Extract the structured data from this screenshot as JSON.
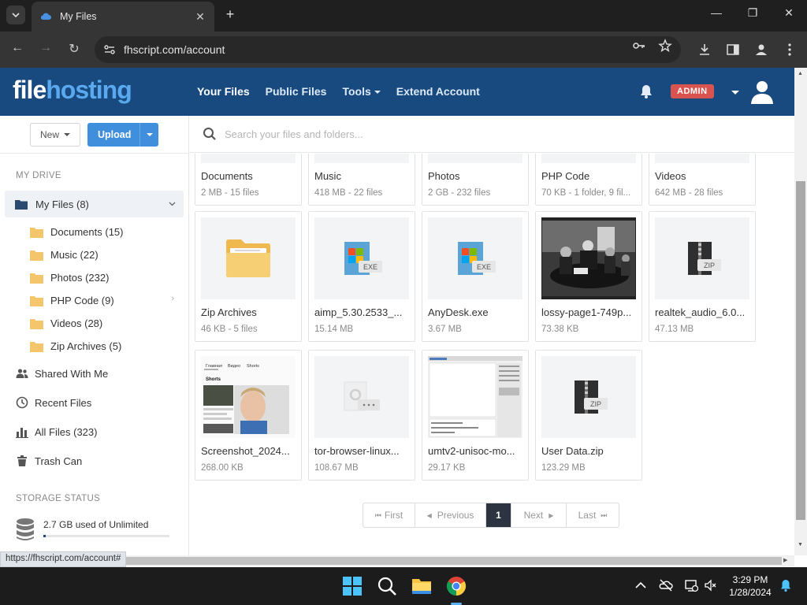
{
  "browser": {
    "tab_title": "My Files",
    "url": "fhscript.com/account",
    "status_url": "https://fhscript.com/account#"
  },
  "site": {
    "logo_part1": "file",
    "logo_part2": "hosting",
    "nav": {
      "your_files": "Your Files",
      "public_files": "Public Files",
      "tools": "Tools",
      "extend_account": "Extend Account"
    },
    "admin_badge": "ADMIN"
  },
  "sidebar": {
    "new_label": "New",
    "upload_label": "Upload",
    "my_drive_heading": "MY DRIVE",
    "my_files": "My Files (8)",
    "folders": [
      {
        "label": "Documents (15)"
      },
      {
        "label": "Music (22)"
      },
      {
        "label": "Photos (232)"
      },
      {
        "label": "PHP Code (9)"
      },
      {
        "label": "Videos (28)"
      },
      {
        "label": "Zip Archives (5)"
      }
    ],
    "shared": "Shared With Me",
    "recent": "Recent Files",
    "all_files": "All Files (323)",
    "trash": "Trash Can",
    "storage_heading": "STORAGE STATUS",
    "storage_text": "2.7 GB used of Unlimited",
    "storage_used_fraction": 0.02
  },
  "search": {
    "placeholder": "Search your files and folders..."
  },
  "top_row": [
    {
      "name": "Documents",
      "meta": "2 MB - 15 files"
    },
    {
      "name": "Music",
      "meta": "418 MB - 22 files"
    },
    {
      "name": "Photos",
      "meta": "2 GB - 232 files"
    },
    {
      "name": "PHP Code",
      "meta": "70 KB - 1 folder, 9 fil..."
    },
    {
      "name": "Videos",
      "meta": "642 MB - 28 files"
    }
  ],
  "row2": [
    {
      "name": "Zip Archives",
      "meta": "46 KB - 5 files",
      "thumb": "folder"
    },
    {
      "name": "aimp_5.30.2533_...",
      "meta": "15.14 MB",
      "thumb": "exe",
      "badge": "EXE"
    },
    {
      "name": "AnyDesk.exe",
      "meta": "3.67 MB",
      "thumb": "exe",
      "badge": "EXE"
    },
    {
      "name": "lossy-page1-749p...",
      "meta": "73.38 KB",
      "thumb": "photo"
    },
    {
      "name": "realtek_audio_6.0...",
      "meta": "47.13 MB",
      "thumb": "zip",
      "badge": "ZIP"
    }
  ],
  "row3": [
    {
      "name": "Screenshot_2024...",
      "meta": "268.00 KB",
      "thumb": "screenshot",
      "tabs": [
        "Главная",
        "Видео",
        "Shorts"
      ],
      "section": "Shorts"
    },
    {
      "name": "tor-browser-linux...",
      "meta": "108.67 MB",
      "thumb": "generic"
    },
    {
      "name": "umtv2-unisoc-mo...",
      "meta": "29.17 KB",
      "thumb": "app-shot"
    },
    {
      "name": "User Data.zip",
      "meta": "123.29 MB",
      "thumb": "zip",
      "badge": "ZIP"
    }
  ],
  "pagination": {
    "first": "First",
    "previous": "Previous",
    "current": "1",
    "next": "Next",
    "last": "Last"
  },
  "taskbar": {
    "time": "3:29 PM",
    "date": "1/28/2024"
  },
  "colors": {
    "header_bg": "#184a80",
    "accent": "#3f8fdd",
    "admin_badge": "#d9534f"
  }
}
